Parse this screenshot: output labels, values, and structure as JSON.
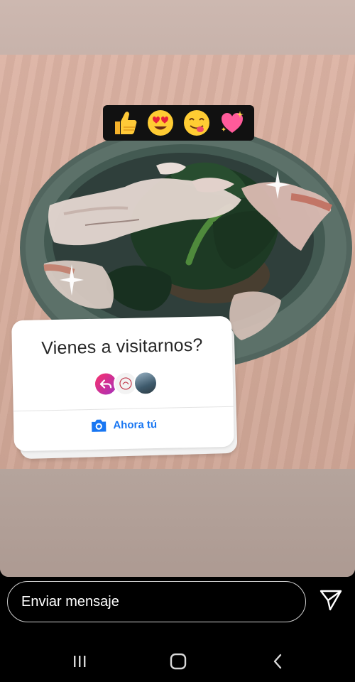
{
  "story": {
    "emojis": [
      "thumbs-up",
      "heart-eyes",
      "yum-face",
      "sparkling-heart"
    ],
    "question_card": {
      "title": "Vienes a visitarnos?",
      "cta_label": "Ahora tú"
    }
  },
  "reply": {
    "placeholder": "Enviar mensaje"
  },
  "system_nav": {
    "buttons": [
      "recents",
      "home",
      "back"
    ]
  },
  "colors": {
    "accent": "#1876f2",
    "card_bg": "#ffffff",
    "emoji_bar_bg": "#111111"
  }
}
